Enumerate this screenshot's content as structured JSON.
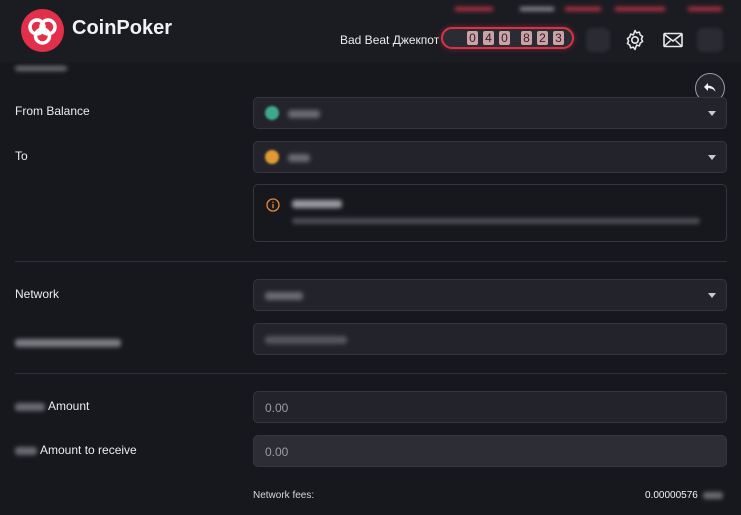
{
  "brand": {
    "name": "CoinPoker"
  },
  "header": {
    "jackpot_label": "Bad Beat Джекпот",
    "jackpot_digits": [
      "0",
      "4",
      "0",
      "8",
      "2",
      "3"
    ]
  },
  "form": {
    "from_balance_label": "From Balance",
    "to_label": "To",
    "network_label": "Network",
    "amount_label": "Amount",
    "amount_value": "0.00",
    "receive_label": "Amount to receive",
    "receive_value": "0.00",
    "fees_label": "Network fees:",
    "fees_value": "0.00000576"
  },
  "colors": {
    "accent": "#e3304a",
    "background": "#17181d",
    "warning": "#e8893a"
  },
  "icons": [
    "coinpoker-logo-icon",
    "settings-gear-icon",
    "mail-envelope-icon",
    "back-arrow-icon",
    "info-circle-icon",
    "chevron-down-icon"
  ]
}
